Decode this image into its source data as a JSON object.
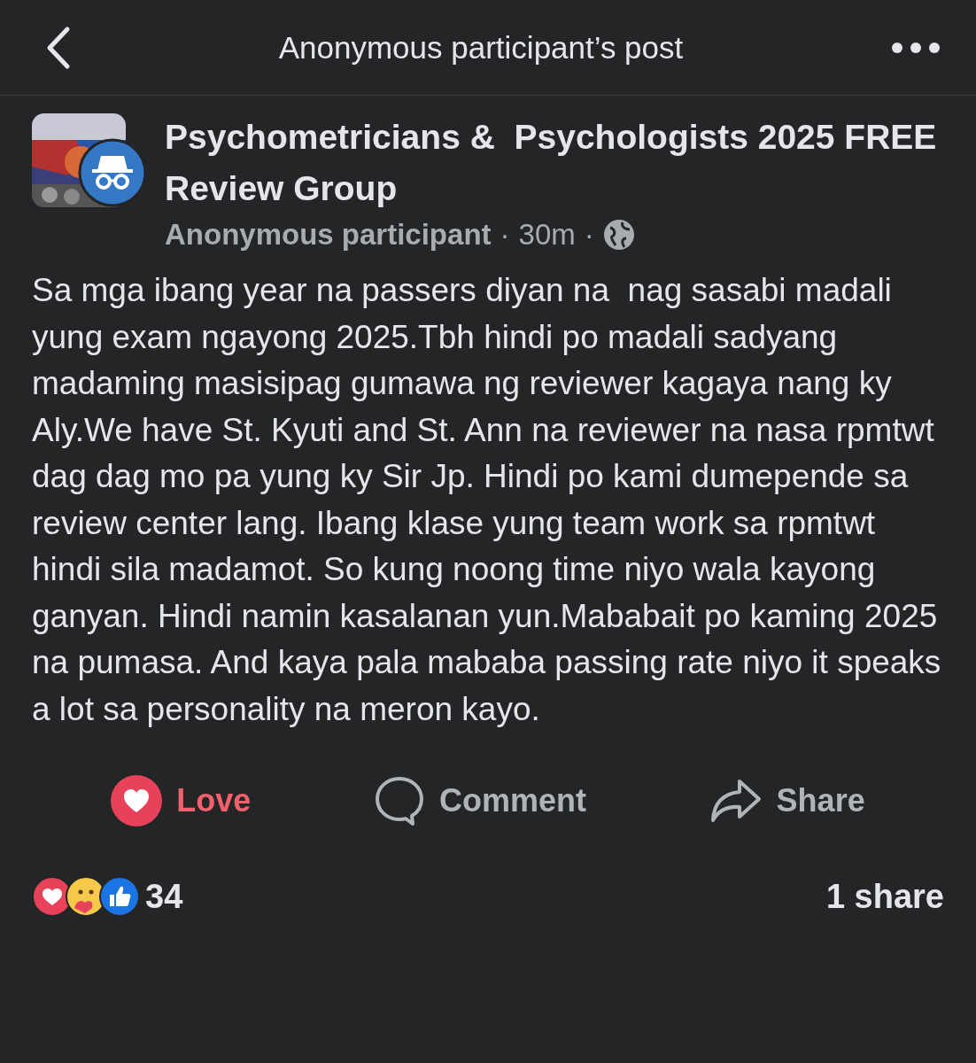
{
  "header": {
    "title": "Anonymous participant’s post"
  },
  "post": {
    "group": "Psychometricians &  Psychologists 2025 FREE Review Group",
    "author": "Anonymous participant",
    "time": "30m",
    "separator": "·",
    "body": "Sa mga ibang year na passers diyan na  nag sasabi madali yung exam ngayong 2025.Tbh hindi po madali sadyang madaming masisipag gumawa ng reviewer kagaya nang ky Aly.We have St. Kyuti and St. Ann na reviewer na nasa rpmtwt dag dag mo pa yung ky Sir Jp. Hindi po kami dumepende sa review center lang. Ibang klase yung team work sa rpmtwt hindi sila madamot. So kung noong time niyo wala kayong ganyan. Hindi namin kasalanan yun.Mababait po kaming 2025 na pumasa. And kaya pala mababa passing rate niyo it speaks a lot sa personality na meron kayo."
  },
  "actions": [
    {
      "kind": "love",
      "label": "Love",
      "selected": true
    },
    {
      "kind": "comment",
      "label": "Comment",
      "selected": false
    },
    {
      "kind": "share",
      "label": "Share",
      "selected": false
    }
  ],
  "reactions": {
    "icons": [
      {
        "kind": "love"
      },
      {
        "kind": "care"
      },
      {
        "kind": "like"
      }
    ],
    "count": "34",
    "shares": "1 share"
  }
}
